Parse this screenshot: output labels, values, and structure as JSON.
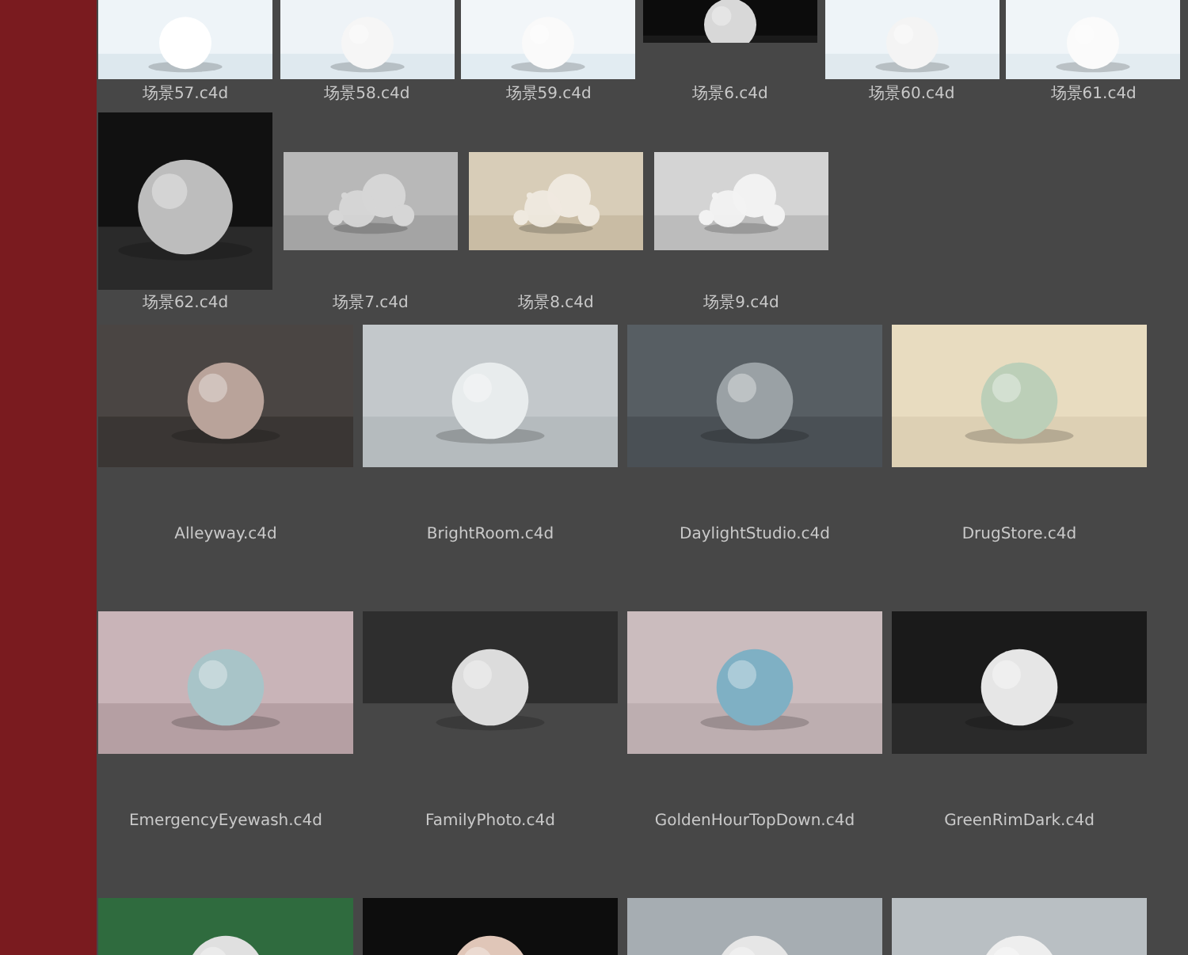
{
  "small_rows": [
    {
      "items": [
        {
          "name": "场景57.c4d",
          "thumb": {
            "kind": "picture"
          }
        },
        {
          "name": "场景58.c4d",
          "thumb": {
            "kind": "picture"
          }
        },
        {
          "name": "场景59.c4d",
          "thumb": {
            "kind": "picture"
          }
        },
        {
          "name": "场景6.c4d",
          "thumb": {
            "kind": "picture"
          }
        },
        {
          "name": "场景60.c4d",
          "thumb": {
            "kind": "picture"
          }
        },
        {
          "name": "场景61.c4d",
          "thumb": {
            "kind": "picture"
          }
        }
      ]
    },
    {
      "items": [
        {
          "name": "场景62.c4d",
          "thumb": {
            "kind": "picture"
          }
        },
        {
          "name": "场景7.c4d",
          "thumb": {
            "kind": "picture"
          }
        },
        {
          "name": "场景8.c4d",
          "thumb": {
            "kind": "picture"
          }
        },
        {
          "name": "场景9.c4d",
          "thumb": {
            "kind": "picture"
          }
        }
      ]
    }
  ],
  "large_rows": [
    {
      "items": [
        {
          "name": "Alleyway.c4d",
          "thumb": {
            "kind": "picture"
          }
        },
        {
          "name": "BrightRoom.c4d",
          "thumb": {
            "kind": "picture"
          }
        },
        {
          "name": "DaylightStudio.c4d",
          "thumb": {
            "kind": "picture"
          }
        },
        {
          "name": "DrugStore.c4d",
          "thumb": {
            "kind": "picture"
          }
        }
      ]
    },
    {
      "items": [
        {
          "name": "EmergencyEyewash.c4d",
          "thumb": {
            "kind": "picture"
          }
        },
        {
          "name": "FamilyPhoto.c4d",
          "thumb": {
            "kind": "picture"
          }
        },
        {
          "name": "GoldenHourTopDown.c4d",
          "thumb": {
            "kind": "picture"
          }
        },
        {
          "name": "GreenRimDark.c4d",
          "thumb": {
            "kind": "picture"
          }
        }
      ]
    },
    {
      "items": [
        {
          "thumb": {
            "kind": "picture"
          }
        },
        {
          "thumb": {
            "kind": "picture"
          }
        },
        {
          "thumb": {
            "kind": "picture"
          }
        },
        {
          "thumb": {
            "kind": "picture"
          }
        }
      ]
    }
  ]
}
